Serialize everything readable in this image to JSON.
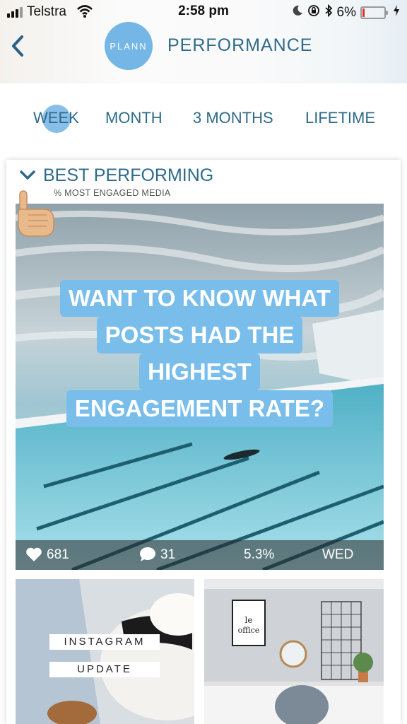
{
  "status_bar": {
    "carrier": "Telstra",
    "time": "2:58 pm",
    "battery": "6%"
  },
  "header": {
    "logo_text": "PLANN",
    "title": "PERFORMANCE"
  },
  "tabs": [
    {
      "label": "WEEK",
      "active": true
    },
    {
      "label": "MONTH",
      "active": false
    },
    {
      "label": "3 MONTHS",
      "active": false
    },
    {
      "label": "LIFETIME",
      "active": false
    }
  ],
  "section": {
    "title": "BEST PERFORMING",
    "subtitle": "% MOST ENGAGED MEDIA"
  },
  "featured_post": {
    "headline": [
      "WANT TO KNOW WHAT",
      "POSTS HAD THE",
      "HIGHEST",
      "ENGAGEMENT RATE?"
    ],
    "likes": "681",
    "comments": "31",
    "engagement_rate": "5.3%",
    "day": "WED"
  },
  "thumbnails": [
    {
      "labels": [
        "INSTAGRAM",
        "UPDATE"
      ]
    },
    {
      "labels": []
    }
  ],
  "colors": {
    "accent": "#74b7e6",
    "text": "#2e6b8a",
    "battery_low": "#e0302a"
  },
  "icons": [
    "back-icon",
    "chevron-down-icon",
    "heart-icon",
    "comment-icon",
    "pointing-hand-icon",
    "wifi-icon",
    "bluetooth-icon",
    "moon-icon",
    "lock-rotation-icon",
    "charging-icon"
  ]
}
